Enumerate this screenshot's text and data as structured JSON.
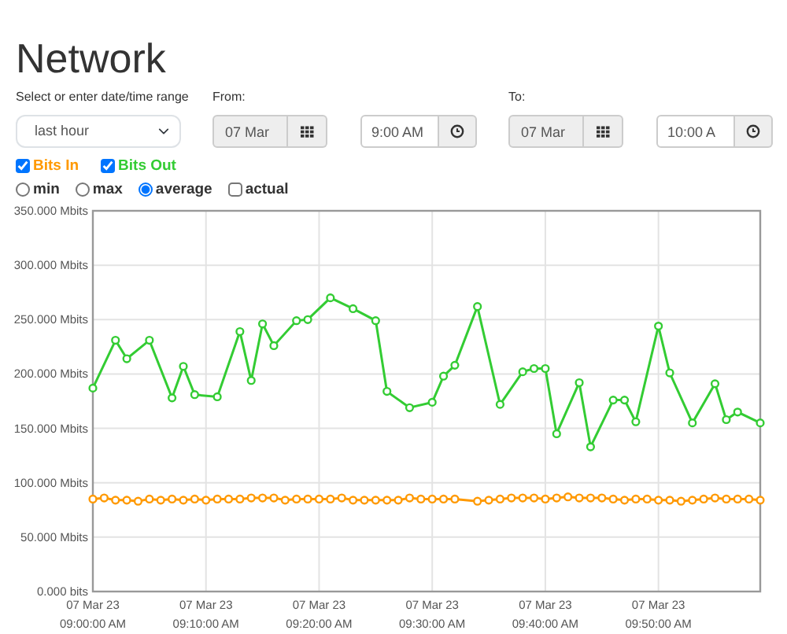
{
  "title": "Network",
  "range": {
    "label": "Select or enter date/time range",
    "value": "last hour"
  },
  "from": {
    "label": "From:",
    "date": "07 Mar",
    "time": "9:00 AM"
  },
  "to": {
    "label": "To:",
    "date": "07 Mar",
    "time": "10:00 A"
  },
  "modes": [
    {
      "kind": "radio",
      "label": "min",
      "selected": false
    },
    {
      "kind": "radio",
      "label": "max",
      "selected": false
    },
    {
      "kind": "radio",
      "label": "average",
      "selected": true
    },
    {
      "kind": "checkbox",
      "label": "actual",
      "selected": false
    }
  ],
  "chart": {
    "series_toggles": [
      {
        "checked": true
      },
      {
        "checked": true
      }
    ],
    "chart_data": {
      "type": "line",
      "grid": true,
      "ylim": [
        0,
        350
      ],
      "yticks": [
        {
          "value": 0,
          "label": "0.000 bits"
        },
        {
          "value": 50,
          "label": "50.000 Mbits"
        },
        {
          "value": 100,
          "label": "100.000 Mbits"
        },
        {
          "value": 150,
          "label": "150.000 Mbits"
        },
        {
          "value": 200,
          "label": "200.000 Mbits"
        },
        {
          "value": 250,
          "label": "250.000 Mbits"
        },
        {
          "value": 300,
          "label": "300.000 Mbits"
        },
        {
          "value": 350,
          "label": "350.000 Mbits"
        }
      ],
      "categories": [
        "07 Mar 23\n09:00:00 AM",
        null,
        null,
        null,
        null,
        null,
        null,
        null,
        null,
        null,
        "07 Mar 23\n09:10:00 AM",
        null,
        null,
        null,
        null,
        null,
        null,
        null,
        null,
        null,
        "07 Mar 23\n09:20:00 AM",
        null,
        null,
        null,
        null,
        null,
        null,
        null,
        null,
        null,
        "07 Mar 23\n09:30:00 AM",
        null,
        null,
        null,
        null,
        null,
        null,
        null,
        null,
        null,
        "07 Mar 23\n09:40:00 AM",
        null,
        null,
        null,
        null,
        null,
        null,
        null,
        null,
        null,
        "07 Mar 23\n09:50:00 AM",
        null,
        null,
        null,
        null,
        null,
        null,
        null,
        null,
        null
      ],
      "series": [
        {
          "name": "Bits In",
          "color": "#ff9900",
          "marker": true,
          "values": [
            85,
            86,
            84,
            84,
            83,
            85,
            84,
            85,
            84,
            85,
            84,
            85,
            85,
            85,
            86,
            86,
            86,
            84,
            85,
            85,
            85,
            85,
            86,
            84,
            84,
            84,
            84,
            84,
            86,
            85,
            85,
            85,
            85,
            null,
            83,
            84,
            85,
            86,
            86,
            86,
            85,
            86,
            87,
            86,
            86,
            86,
            85,
            84,
            85,
            85,
            84,
            84,
            83,
            84,
            85,
            86,
            85,
            85,
            85,
            84
          ]
        },
        {
          "name": "Bits Out",
          "color": "#33cc33",
          "marker": true,
          "values": [
            187,
            null,
            231,
            214,
            null,
            231,
            null,
            178,
            207,
            181,
            null,
            179,
            null,
            239,
            194,
            246,
            226,
            null,
            249,
            250,
            null,
            270,
            null,
            260,
            null,
            249,
            184,
            null,
            169,
            null,
            174,
            198,
            208,
            null,
            262,
            null,
            172,
            null,
            202,
            205,
            205,
            145,
            null,
            192,
            133,
            null,
            176,
            176,
            156,
            null,
            244,
            201,
            null,
            155,
            null,
            191,
            158,
            165,
            null,
            155
          ]
        }
      ]
    }
  }
}
